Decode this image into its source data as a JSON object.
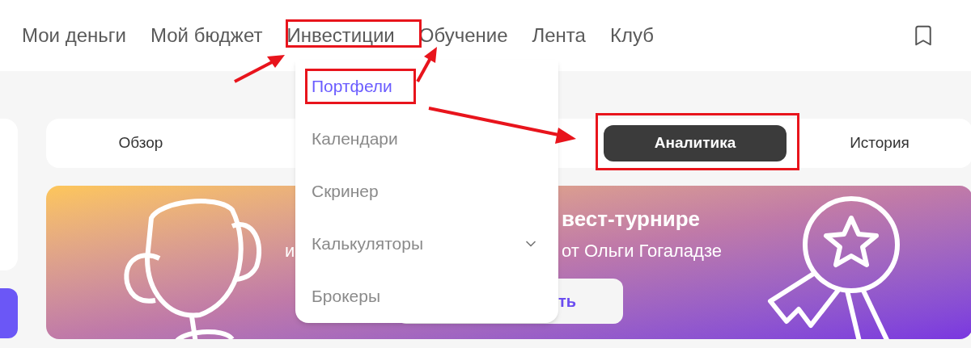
{
  "nav": {
    "items": [
      {
        "label": "Мои деньги"
      },
      {
        "label": "Мой бюджет"
      },
      {
        "label": "Инвестиции"
      },
      {
        "label": "Обучение"
      },
      {
        "label": "Лента"
      },
      {
        "label": "Клуб"
      }
    ]
  },
  "menu": {
    "items": [
      {
        "label": "Портфели",
        "selected": true,
        "kind": "link"
      },
      {
        "label": "Календари",
        "selected": false,
        "kind": "link"
      },
      {
        "label": "Скринер",
        "selected": false,
        "kind": "link"
      },
      {
        "label": "Калькуляторы",
        "selected": false,
        "kind": "submenu"
      },
      {
        "label": "Брокеры",
        "selected": false,
        "kind": "link"
      }
    ]
  },
  "tabs": [
    {
      "label": "Обзор",
      "selected": false
    },
    {
      "label": "Аналитика",
      "selected": true
    },
    {
      "label": "История",
      "selected": false
    }
  ],
  "banner": {
    "title": "вест-турнире",
    "subtitle_start": "и",
    "subtitle_end": "от Ольги Гогаладзе",
    "button": "ть"
  }
}
